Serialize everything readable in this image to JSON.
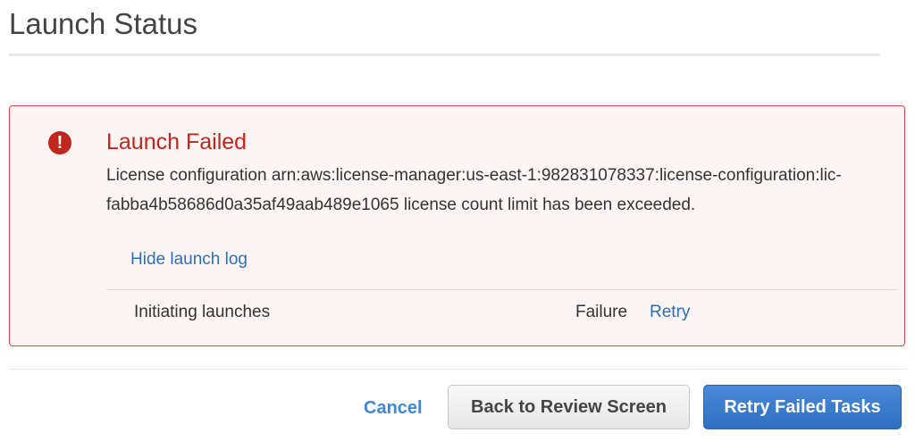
{
  "header": {
    "title": "Launch Status"
  },
  "alert": {
    "icon": "exclamation-circle-icon",
    "title": "Launch Failed",
    "message": "License configuration arn:aws:license-manager:us-east-1:982831078337:license-configuration:lic-fabba4b58686d0a35af49aab489e1065 license count limit has been exceeded.",
    "hide_log": "Hide launch log",
    "log": [
      {
        "step": "Initiating launches",
        "status": "Failure",
        "action": "Retry"
      }
    ]
  },
  "footer": {
    "cancel": "Cancel",
    "back": "Back to Review Screen",
    "retry": "Retry Failed Tasks"
  },
  "colors": {
    "error": "#c0261d",
    "link": "#2c6fbd",
    "primary": "#3a7bcf"
  }
}
